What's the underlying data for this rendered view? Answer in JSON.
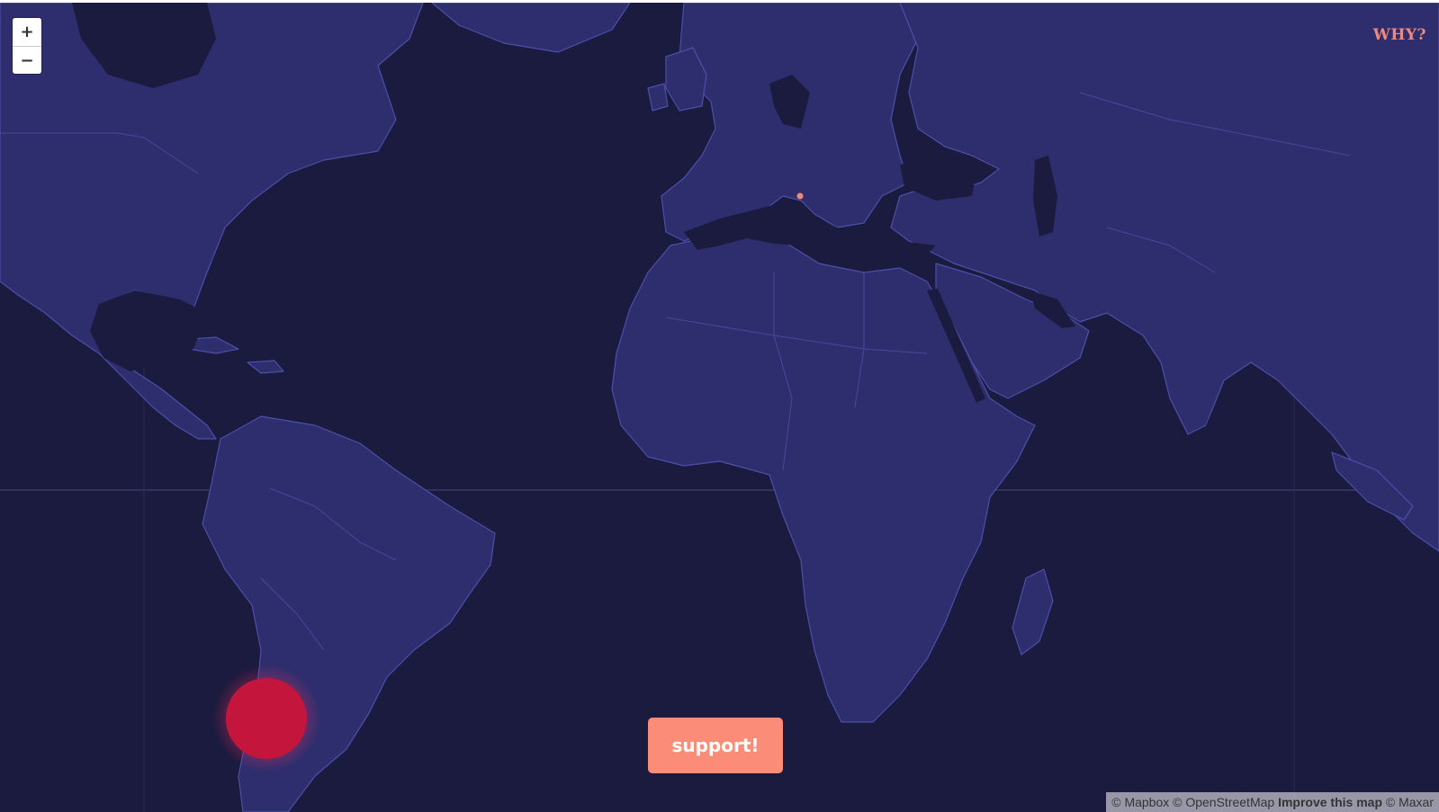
{
  "map": {
    "style": "dark",
    "colors": {
      "ocean": "#1b1a3f",
      "land": "#2e2e6e",
      "border": "#4b4fa8",
      "marker": "#c4163c",
      "marker_glow": "#ff2c55",
      "small_marker": "#f0897a"
    },
    "markers": [
      {
        "name": "large-marker",
        "location": "southern Chile"
      },
      {
        "name": "small-marker",
        "location": "Rome, Italy"
      }
    ]
  },
  "controls": {
    "zoom_in": "+",
    "zoom_out": "−"
  },
  "header": {
    "why_link": "WHY?"
  },
  "cta": {
    "support_label": "support!"
  },
  "attribution": {
    "mapbox": "© Mapbox",
    "osm": "© OpenStreetMap",
    "improve": "Improve this map",
    "maxar": "© Maxar"
  }
}
